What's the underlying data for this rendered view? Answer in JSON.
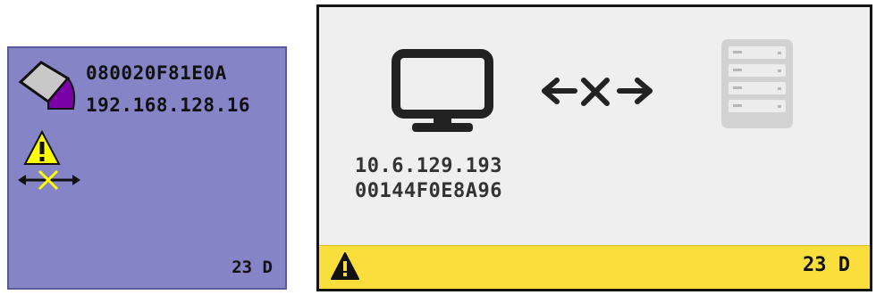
{
  "left_panel": {
    "mac_address": "080020F81E0A",
    "ip_address": "192.168.128.16",
    "days": "23 D",
    "icons": [
      "computer-icon",
      "warning-icon",
      "disconnected-arrows-icon"
    ],
    "colors": {
      "background": "#8484c6",
      "warning": "#ffff00",
      "accent": "#7a00a8"
    }
  },
  "right_panel": {
    "ip_address": "10.6.129.193",
    "mac_address": "00144F0E8A96",
    "icons": [
      "monitor-icon",
      "disconnected-arrow-icon",
      "server-icon"
    ],
    "footer": {
      "warning_icon": "warning-icon",
      "days": "23 D",
      "background": "#fade3b"
    }
  }
}
